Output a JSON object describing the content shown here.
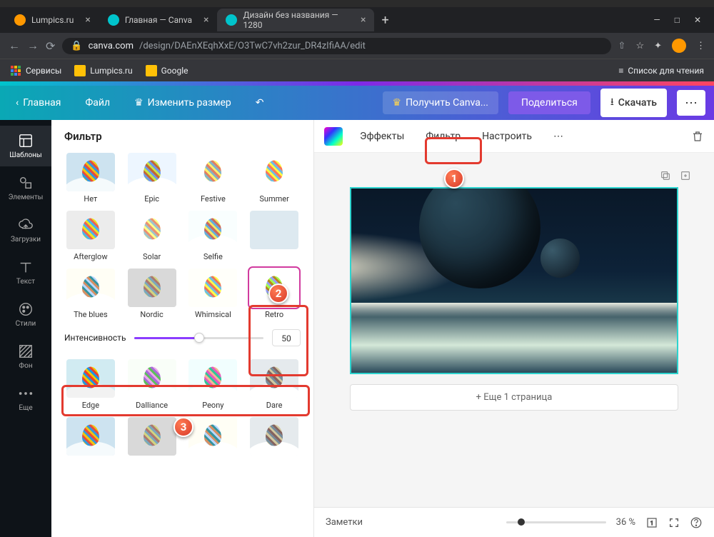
{
  "browser": {
    "tabs": [
      {
        "title": "Lumpics.ru",
        "favicon_color": "#ff9800"
      },
      {
        "title": "Главная — Canva",
        "favicon_color": "#00c4cc"
      },
      {
        "title": "Дизайн без названия — 1280",
        "favicon_color": "#00c4cc"
      }
    ],
    "url_prefix": "canva.com",
    "url_rest": "/design/DAEnXEqhXxE/O3TwC7vh2zur_DR4zIfiAA/edit",
    "bookmarks": {
      "services": "Сервисы",
      "lumpics": "Lumpics.ru",
      "google": "Google",
      "reading_list": "Список для чтения"
    }
  },
  "canva_toolbar": {
    "home": "Главная",
    "file": "Файл",
    "resize": "Изменить размер",
    "get_pro": "Получить Canva...",
    "share": "Поделиться",
    "download": "Скачать"
  },
  "sidebar": {
    "items": [
      {
        "label": "Шаблоны"
      },
      {
        "label": "Элементы"
      },
      {
        "label": "Загрузки"
      },
      {
        "label": "Текст"
      },
      {
        "label": "Стили"
      },
      {
        "label": "Фон"
      },
      {
        "label": "Еще"
      }
    ]
  },
  "filter_panel": {
    "title": "Фильтр",
    "intensity_label": "Интенсивность",
    "intensity_value": "50",
    "filters": [
      "Нет",
      "Epic",
      "Festive",
      "Summer",
      "Afterglow",
      "Solar",
      "Selfie",
      "",
      "The blues",
      "Nordic",
      "Whimsical",
      "Retro",
      "Edge",
      "Dalliance",
      "Peony",
      "Dare"
    ]
  },
  "canvas_tabs": {
    "effects": "Эффекты",
    "filter": "Фильтр",
    "adjust": "Настроить"
  },
  "canvas": {
    "add_page": "+ Еще 1 страница",
    "notes": "Заметки",
    "zoom": "36 %"
  }
}
